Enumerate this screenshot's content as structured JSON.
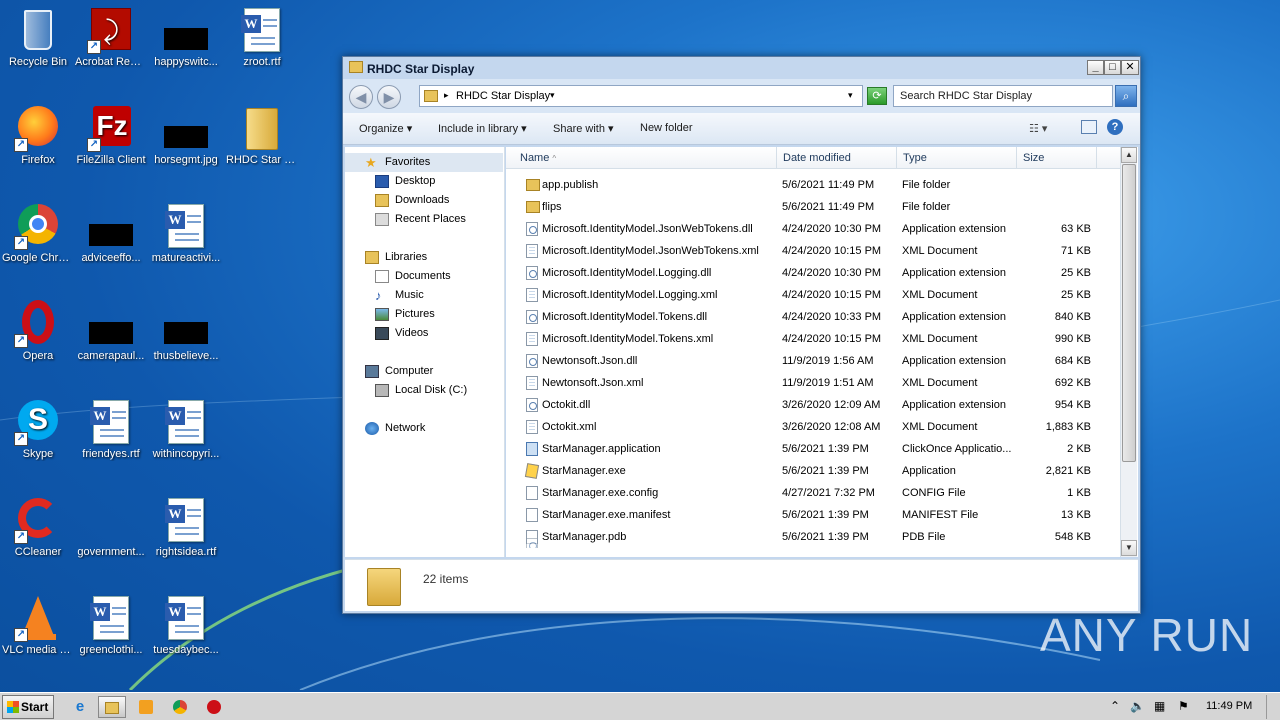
{
  "desktop": {
    "icons": [
      {
        "label": "Recycle Bin"
      },
      {
        "label": "Acrobat Reader DC"
      },
      {
        "label": "happyswitc..."
      },
      {
        "label": "zroot.rtf"
      },
      {
        "label": "Firefox"
      },
      {
        "label": "FileZilla Client"
      },
      {
        "label": "horsegmt.jpg"
      },
      {
        "label": "RHDC Star Display"
      },
      {
        "label": "Google Chrome"
      },
      {
        "label": "adviceeffo..."
      },
      {
        "label": "matureactivi..."
      },
      {
        "label": "Opera"
      },
      {
        "label": "camerapaul..."
      },
      {
        "label": "thusbelieve..."
      },
      {
        "label": "Skype"
      },
      {
        "label": "friendyes.rtf"
      },
      {
        "label": "withincopyri..."
      },
      {
        "label": "CCleaner"
      },
      {
        "label": "government..."
      },
      {
        "label": "rightsidea.rtf"
      },
      {
        "label": "VLC media player"
      },
      {
        "label": "greenclothi..."
      },
      {
        "label": "tuesdaybec..."
      }
    ],
    "watermark": "ANY RUN"
  },
  "window": {
    "title": "RHDC Star Display",
    "buttons": {
      "minimize": "_",
      "maximize": "□",
      "close": "✕"
    },
    "address": {
      "path": "RHDC Star Display",
      "sep": "▸",
      "dropdown": "▾"
    },
    "search": {
      "placeholder": "Search RHDC Star Display"
    },
    "toolbar": {
      "organize": "Organize ▾",
      "include": "Include in library ▾",
      "share": "Share with ▾",
      "newfolder": "New folder"
    },
    "nav": {
      "favorites": "Favorites",
      "desktop": "Desktop",
      "downloads": "Downloads",
      "recent": "Recent Places",
      "libraries": "Libraries",
      "documents": "Documents",
      "music": "Music",
      "pictures": "Pictures",
      "videos": "Videos",
      "computer": "Computer",
      "localdisk": "Local Disk (C:)",
      "network": "Network"
    },
    "columns": {
      "name": "Name",
      "date": "Date modified",
      "type": "Type",
      "size": "Size"
    },
    "files": [
      {
        "name": "app.publish",
        "date": "5/6/2021 11:49 PM",
        "type": "File folder",
        "size": "",
        "icon": "folder"
      },
      {
        "name": "flips",
        "date": "5/6/2021 11:49 PM",
        "type": "File folder",
        "size": "",
        "icon": "folder"
      },
      {
        "name": "Microsoft.IdentityModel.JsonWebTokens.dll",
        "date": "4/24/2020 10:30 PM",
        "type": "Application extension",
        "size": "63 KB",
        "icon": "dll"
      },
      {
        "name": "Microsoft.IdentityModel.JsonWebTokens.xml",
        "date": "4/24/2020 10:15 PM",
        "type": "XML Document",
        "size": "71 KB",
        "icon": "xml"
      },
      {
        "name": "Microsoft.IdentityModel.Logging.dll",
        "date": "4/24/2020 10:30 PM",
        "type": "Application extension",
        "size": "25 KB",
        "icon": "dll"
      },
      {
        "name": "Microsoft.IdentityModel.Logging.xml",
        "date": "4/24/2020 10:15 PM",
        "type": "XML Document",
        "size": "25 KB",
        "icon": "xml"
      },
      {
        "name": "Microsoft.IdentityModel.Tokens.dll",
        "date": "4/24/2020 10:33 PM",
        "type": "Application extension",
        "size": "840 KB",
        "icon": "dll"
      },
      {
        "name": "Microsoft.IdentityModel.Tokens.xml",
        "date": "4/24/2020 10:15 PM",
        "type": "XML Document",
        "size": "990 KB",
        "icon": "xml"
      },
      {
        "name": "Newtonsoft.Json.dll",
        "date": "11/9/2019 1:56 AM",
        "type": "Application extension",
        "size": "684 KB",
        "icon": "dll"
      },
      {
        "name": "Newtonsoft.Json.xml",
        "date": "11/9/2019 1:51 AM",
        "type": "XML Document",
        "size": "692 KB",
        "icon": "xml"
      },
      {
        "name": "Octokit.dll",
        "date": "3/26/2020 12:09 AM",
        "type": "Application extension",
        "size": "954 KB",
        "icon": "dll"
      },
      {
        "name": "Octokit.xml",
        "date": "3/26/2020 12:08 AM",
        "type": "XML Document",
        "size": "1,883 KB",
        "icon": "xml"
      },
      {
        "name": "StarManager.application",
        "date": "5/6/2021 1:39 PM",
        "type": "ClickOnce Applicatio...",
        "size": "2 KB",
        "icon": "app"
      },
      {
        "name": "StarManager.exe",
        "date": "5/6/2021 1:39 PM",
        "type": "Application",
        "size": "2,821 KB",
        "icon": "exe"
      },
      {
        "name": "StarManager.exe.config",
        "date": "4/27/2021 7:32 PM",
        "type": "CONFIG File",
        "size": "1 KB",
        "icon": "file"
      },
      {
        "name": "StarManager.exe.manifest",
        "date": "5/6/2021 1:39 PM",
        "type": "MANIFEST File",
        "size": "13 KB",
        "icon": "file"
      },
      {
        "name": "StarManager.pdb",
        "date": "5/6/2021 1:39 PM",
        "type": "PDB File",
        "size": "548 KB",
        "icon": "file"
      }
    ],
    "item_count": "22 items"
  },
  "taskbar": {
    "start": "Start",
    "clock": "11:49 PM"
  }
}
